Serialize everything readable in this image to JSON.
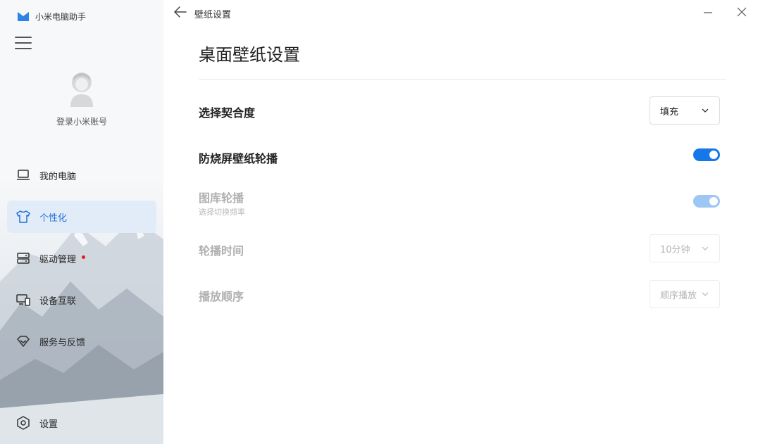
{
  "app": {
    "name": "小米电脑助手"
  },
  "account": {
    "login_label": "登录小米账号"
  },
  "sidebar": {
    "items": [
      {
        "label": "我的电脑",
        "icon": "laptop-icon",
        "active": false
      },
      {
        "label": "个性化",
        "icon": "tshirt-icon",
        "active": true
      },
      {
        "label": "驱动管理",
        "icon": "server-icon",
        "active": false,
        "badge": "red-dot"
      },
      {
        "label": "设备互联",
        "icon": "devices-icon",
        "active": false
      },
      {
        "label": "服务与反馈",
        "icon": "diamond-icon",
        "active": false
      }
    ],
    "settings_label": "设置"
  },
  "header": {
    "breadcrumb": "壁纸设置"
  },
  "main": {
    "title": "桌面壁纸设置",
    "fit": {
      "label": "选择契合度",
      "value": "填充"
    },
    "anti_burn": {
      "label": "防烧屏壁纸轮播",
      "enabled": true
    },
    "gallery": {
      "label": "图库轮播",
      "sub": "选择切换频率",
      "enabled": true,
      "disabled": true
    },
    "interval": {
      "label": "轮播时间",
      "value": "10分钟",
      "disabled": true
    },
    "order": {
      "label": "播放顺序",
      "value": "顺序播放",
      "disabled": true
    }
  },
  "colors": {
    "accent": "#1677e8",
    "active_bg": "#e2ecf8",
    "badge": "#e02020"
  }
}
